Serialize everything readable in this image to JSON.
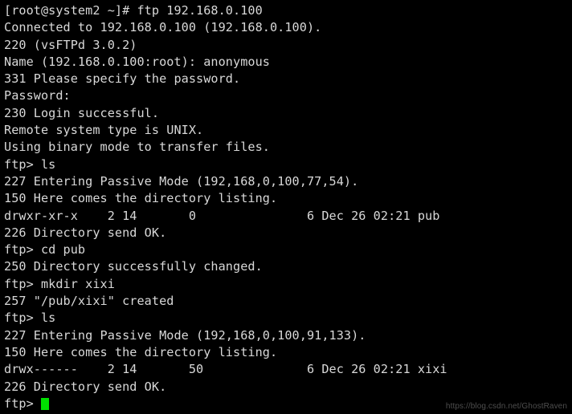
{
  "terminal": {
    "background_color": "#000000",
    "text_color": "#d8d8d8",
    "cursor_color": "#00e000",
    "lines": [
      "[root@system2 ~]# ftp 192.168.0.100",
      "Connected to 192.168.0.100 (192.168.0.100).",
      "220 (vsFTPd 3.0.2)",
      "Name (192.168.0.100:root): anonymous",
      "331 Please specify the password.",
      "Password:",
      "230 Login successful.",
      "Remote system type is UNIX.",
      "Using binary mode to transfer files.",
      "ftp> ls",
      "227 Entering Passive Mode (192,168,0,100,77,54).",
      "150 Here comes the directory listing.",
      "drwxr-xr-x    2 14       0               6 Dec 26 02:21 pub",
      "226 Directory send OK.",
      "ftp> cd pub",
      "250 Directory successfully changed.",
      "ftp> mkdir xixi",
      "257 \"/pub/xixi\" created",
      "ftp> ls",
      "227 Entering Passive Mode (192,168,0,100,91,133).",
      "150 Here comes the directory listing.",
      "drwx------    2 14       50              6 Dec 26 02:21 xixi",
      "226 Directory send OK."
    ],
    "prompt_line": {
      "prompt": "ftp> ",
      "input_value": ""
    }
  },
  "watermark": {
    "text": "https://blog.csdn.net/GhostRaven"
  }
}
